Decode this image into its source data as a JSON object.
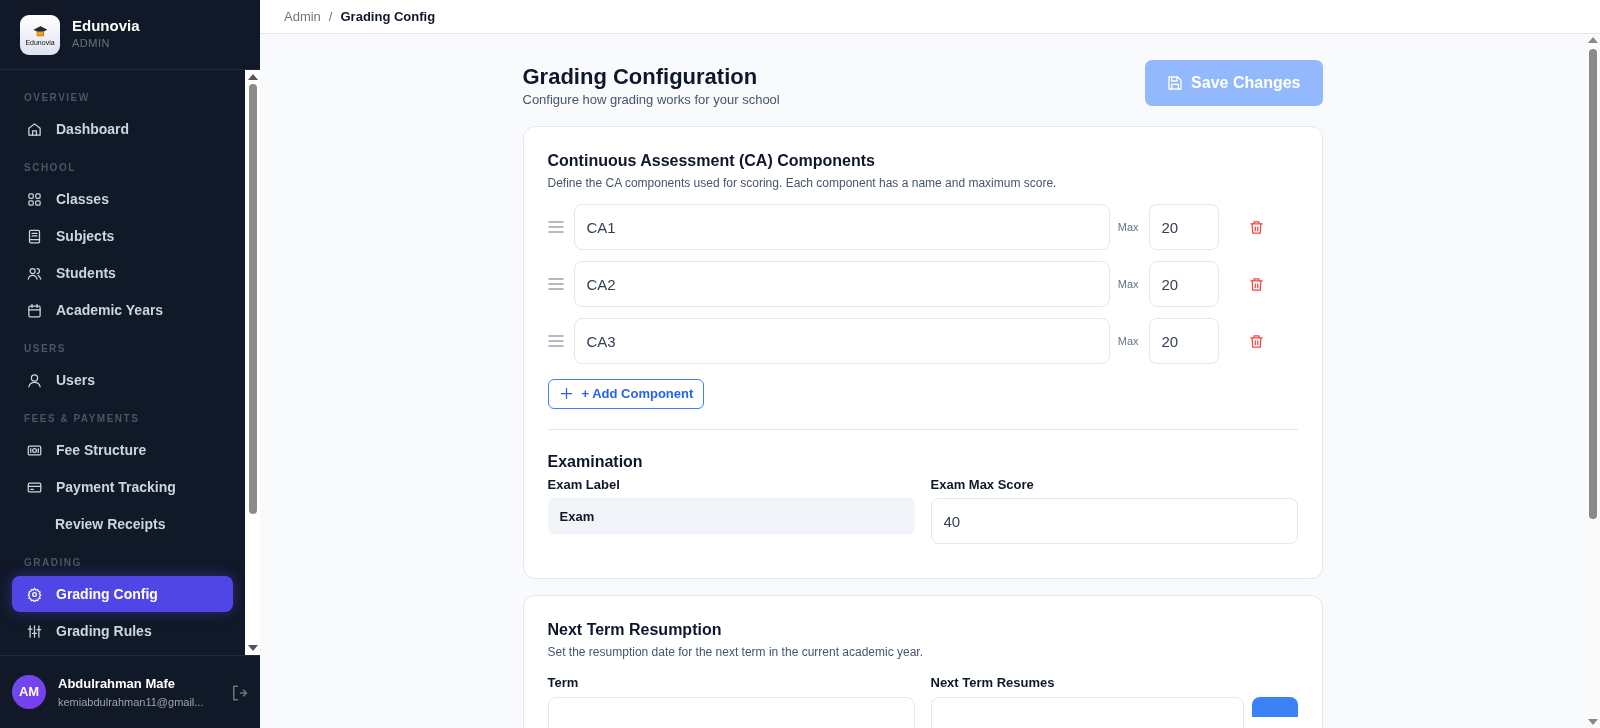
{
  "brand": {
    "name": "Edunovia",
    "role": "ADMIN",
    "logo_text": "Edunovia"
  },
  "sidebar": {
    "sections": [
      {
        "label": "OVERVIEW",
        "items": [
          {
            "label": "Dashboard",
            "selected": false
          }
        ]
      },
      {
        "label": "SCHOOL",
        "items": [
          {
            "label": "Classes",
            "selected": false
          },
          {
            "label": "Subjects",
            "selected": false
          },
          {
            "label": "Students",
            "selected": false
          },
          {
            "label": "Academic Years",
            "selected": false
          }
        ]
      },
      {
        "label": "USERS",
        "items": [
          {
            "label": "Users",
            "selected": false
          }
        ]
      },
      {
        "label": "FEES & PAYMENTS",
        "items": [
          {
            "label": "Fee Structure",
            "selected": false
          },
          {
            "label": "Payment Tracking",
            "selected": false
          },
          {
            "label": "Review Receipts",
            "selected": false
          }
        ]
      },
      {
        "label": "GRADING",
        "items": [
          {
            "label": "Grading Config",
            "selected": true
          },
          {
            "label": "Grading Rules",
            "selected": false
          }
        ]
      }
    ]
  },
  "user": {
    "initials": "AM",
    "name": "Abdulrahman Mafe",
    "email": "kemiabdulrahman11@gmail..."
  },
  "breadcrumb": [
    "Admin",
    "Grading Config"
  ],
  "breadcrumb_separator": "/",
  "page": {
    "title": "Grading Configuration",
    "subtitle": "Configure how grading works for your school",
    "save_button": {
      "label": "Save Changes",
      "disabled": true
    }
  },
  "ca_card": {
    "title": "Continuous Assessment (CA) Components",
    "description": "Define the CA components used for scoring. Each component has a name and maximum score.",
    "components": [
      {
        "name": "CA1",
        "max_label": "Max",
        "max": "20"
      },
      {
        "name": "CA2",
        "max_label": "Max",
        "max": "20"
      },
      {
        "name": "CA3",
        "max_label": "Max",
        "max": "20"
      }
    ],
    "add_button": "+ Add Component",
    "exam": {
      "title": "Examination",
      "label_field": "Exam Label",
      "label_value": "Exam",
      "max_field": "Exam Max Score",
      "max_value": "40"
    }
  },
  "resumption_card": {
    "title": "Next Term Resumption",
    "description": "Set the resumption date for the next term in the current academic year.",
    "term_label": "Term",
    "date_label": "Next Term Resumes"
  }
}
